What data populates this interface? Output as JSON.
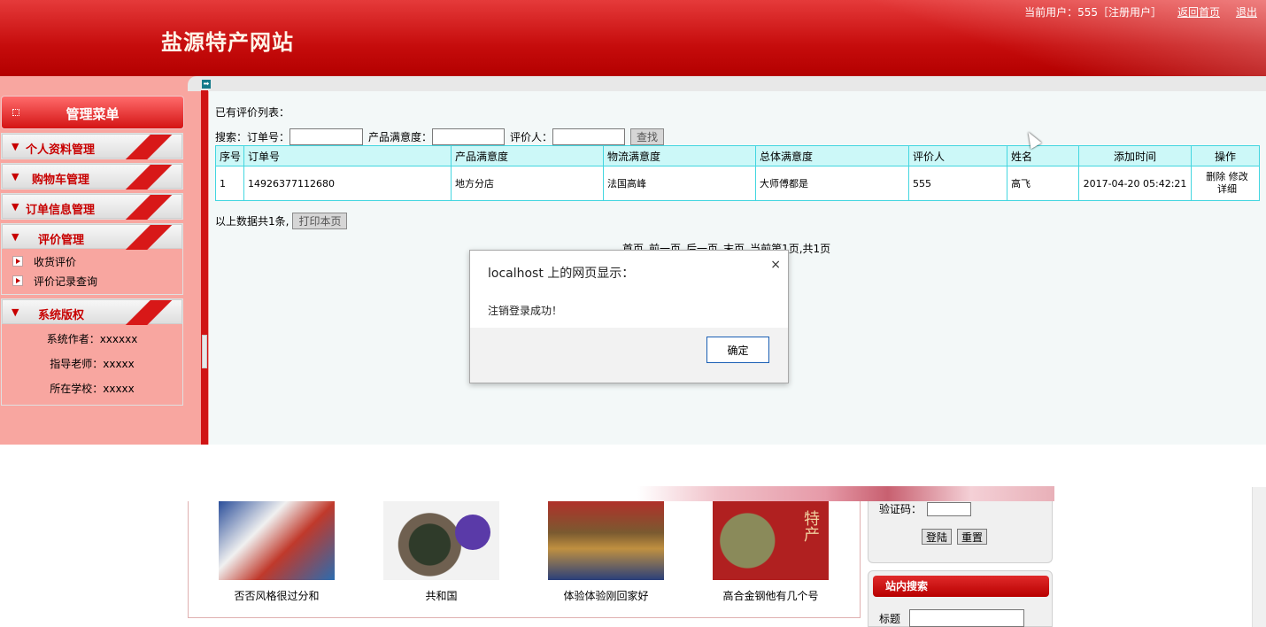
{
  "header": {
    "site_title": "盐源特产网站",
    "user_info": "当前用户：555［注册用户］",
    "home_link": "返回首页",
    "logout_link": "退出"
  },
  "sidebar": {
    "menu_title": "管理菜单",
    "groups": [
      {
        "label": "个人资料管理"
      },
      {
        "label": "购物车管理"
      },
      {
        "label": "订单信息管理"
      },
      {
        "label": "评价管理",
        "items": [
          "收货评价",
          "评价记录查询"
        ]
      },
      {
        "label": "系统版权",
        "credits": [
          "系统作者：xxxxxx",
          "指导老师：xxxxx",
          "所在学校：xxxxx"
        ]
      }
    ]
  },
  "main": {
    "list_title": "已有评价列表：",
    "search": {
      "prefix": "搜索：订单号：",
      "product_label": "产品满意度：",
      "reviewer_label": "评价人：",
      "button": "查找",
      "order_value": "",
      "product_value": "",
      "reviewer_value": ""
    },
    "table": {
      "headers": [
        "序号",
        "订单号",
        "产品满意度",
        "物流满意度",
        "总体满意度",
        "评价人",
        "姓名",
        "添加时间",
        "操作"
      ],
      "rows": [
        {
          "index": "1",
          "order_no": "14926377112680",
          "product": "地方分店",
          "logistics": "法国高峰",
          "overall": "大师傅都是",
          "reviewer": "555",
          "name": "高飞",
          "time": "2017-04-20 05:42:21",
          "actions": {
            "delete": "删除",
            "edit": "修改",
            "detail": "详细"
          }
        }
      ]
    },
    "summary": "以上数据共1条,",
    "print_button": "打印本页",
    "pager": {
      "first": "首页",
      "prev": "前一页",
      "next": "后一页",
      "last": "末页",
      "status": "当前第1页,共1页"
    }
  },
  "lower": {
    "products": [
      {
        "caption": "否否风格很过分和",
        "icon": "thangka-image"
      },
      {
        "caption": "共和国",
        "icon": "tea-bowl-image"
      },
      {
        "caption": "体验体验刚回家好",
        "icon": "buddha-image"
      },
      {
        "caption": "高合金钢他有几个号",
        "icon": "specialty-gift-box-image"
      }
    ],
    "login": {
      "captcha_label": "验证码：",
      "captcha_value": "",
      "login_button": "登陆",
      "reset_button": "重置"
    },
    "site_search": {
      "title": "站内搜索",
      "title_label": "标题",
      "title_value": ""
    }
  },
  "dialog": {
    "title": "localhost 上的网页显示：",
    "message": "注销登录成功！",
    "ok_button": "确定",
    "close_glyph": "×"
  },
  "colors": {
    "header_red": "#c60c0c",
    "sidebar_pink": "#f8a6a0",
    "table_border": "#43d6e0",
    "table_header_bg": "#ccf8f8",
    "dialog_ok_border": "#1a5fb4"
  }
}
